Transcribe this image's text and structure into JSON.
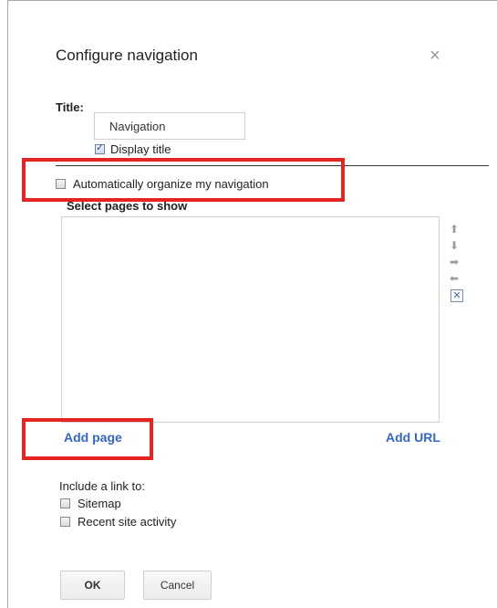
{
  "dialog": {
    "title": "Configure navigation",
    "close_glyph": "×"
  },
  "title_field": {
    "label": "Title:",
    "value": "Navigation",
    "display_title_label": "Display title",
    "display_title_checked": true
  },
  "auto_organize": {
    "label": "Automatically organize my navigation",
    "checked": false
  },
  "pages": {
    "label": "Select pages to show",
    "items": [],
    "controls": {
      "up_glyph": "⬆",
      "down_glyph": "⬇",
      "right_glyph": "➡",
      "left_glyph": "⬅",
      "remove_glyph": "✕"
    }
  },
  "links": {
    "add_page": "Add page",
    "add_url": "Add URL"
  },
  "include": {
    "label": "Include a link to:",
    "options": [
      {
        "label": "Sitemap",
        "checked": false
      },
      {
        "label": "Recent site activity",
        "checked": false
      }
    ]
  },
  "buttons": {
    "ok": "OK",
    "cancel": "Cancel"
  },
  "colors": {
    "link": "#3366cc",
    "highlight": "#e52424"
  }
}
